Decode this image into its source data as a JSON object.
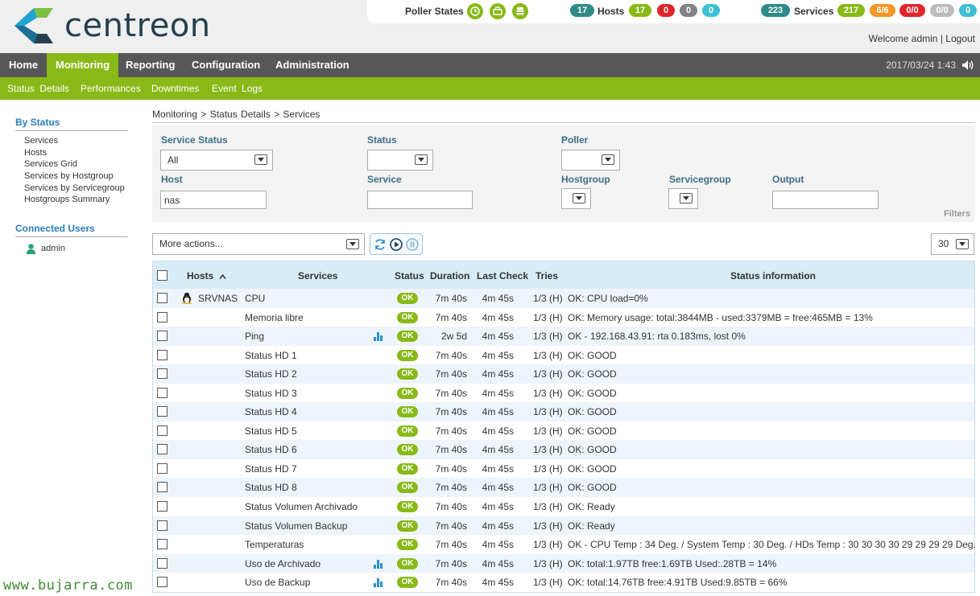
{
  "brand": "centreon",
  "header": {
    "poller_label": "Poller States",
    "hosts_total": "17",
    "hosts_label": "Hosts",
    "hosts_up": "17",
    "hosts_down": "0",
    "hosts_unreach": "0",
    "hosts_pending": "0",
    "services_total": "223",
    "services_label": "Services",
    "services_ok": "217",
    "services_warning": "6/6",
    "services_critical": "0/0",
    "services_unknown": "0/0",
    "services_pending": "0",
    "welcome": "Welcome admin",
    "separator": "|",
    "logout": "Logout"
  },
  "nav": {
    "items": [
      "Home",
      "Monitoring",
      "Reporting",
      "Configuration",
      "Administration"
    ],
    "datetime": "2017/03/24 1:43"
  },
  "subnav": [
    "Status Details",
    "Performances",
    "Downtimes",
    "Event Logs"
  ],
  "sidebar": {
    "by_status_title": "By Status",
    "links": [
      "Services",
      "Hosts",
      "Services Grid",
      "Services by Hostgroup",
      "Services by Servicegroup",
      "Hostgroups Summary"
    ],
    "users_title": "Connected Users",
    "user": "admin"
  },
  "watermark": "www.bujarra.com",
  "breadcrumb": "Monitoring  >  Status Details  >  Services",
  "filters": {
    "service_status_label": "Service Status",
    "service_status_value": "All",
    "status_label": "Status",
    "poller_label": "Poller",
    "host_label": "Host",
    "host_value": "nas",
    "service_label": "Service",
    "hostgroup_label": "Hostgroup",
    "servicegroup_label": "Servicegroup",
    "output_label": "Output",
    "filters_tag": "Filters"
  },
  "toolbar": {
    "more_actions": "More actions...",
    "page_size": "30"
  },
  "table": {
    "headers": {
      "hosts": "Hosts",
      "services": "Services",
      "status": "Status",
      "duration": "Duration",
      "last_check": "Last Check",
      "tries": "Tries",
      "status_info": "Status information"
    },
    "sort_indicator": "^",
    "host": "SRVNAS",
    "rows": [
      {
        "service": "CPU",
        "graph": false,
        "status": "OK",
        "duration": "7m 40s",
        "last_check": "4m 45s",
        "tries": "1/3 (H)",
        "info": "OK: CPU load=0%"
      },
      {
        "service": "Memoria libre",
        "graph": false,
        "status": "OK",
        "duration": "7m 40s",
        "last_check": "4m 45s",
        "tries": "1/3 (H)",
        "info": "OK: Memory usage: total:3844MB - used:3379MB = free:465MB = 13%"
      },
      {
        "service": "Ping",
        "graph": true,
        "status": "OK",
        "duration": "2w 5d",
        "last_check": "4m 45s",
        "tries": "1/3 (H)",
        "info": "OK - 192.168.43.91: rta 0.183ms, lost 0%"
      },
      {
        "service": "Status HD 1",
        "graph": false,
        "status": "OK",
        "duration": "7m 40s",
        "last_check": "4m 45s",
        "tries": "1/3 (H)",
        "info": "OK: GOOD"
      },
      {
        "service": "Status HD 2",
        "graph": false,
        "status": "OK",
        "duration": "7m 40s",
        "last_check": "4m 45s",
        "tries": "1/3 (H)",
        "info": "OK: GOOD"
      },
      {
        "service": "Status HD 3",
        "graph": false,
        "status": "OK",
        "duration": "7m 40s",
        "last_check": "4m 45s",
        "tries": "1/3 (H)",
        "info": "OK: GOOD"
      },
      {
        "service": "Status HD 4",
        "graph": false,
        "status": "OK",
        "duration": "7m 40s",
        "last_check": "4m 45s",
        "tries": "1/3 (H)",
        "info": "OK: GOOD"
      },
      {
        "service": "Status HD 5",
        "graph": false,
        "status": "OK",
        "duration": "7m 40s",
        "last_check": "4m 45s",
        "tries": "1/3 (H)",
        "info": "OK: GOOD"
      },
      {
        "service": "Status HD 6",
        "graph": false,
        "status": "OK",
        "duration": "7m 40s",
        "last_check": "4m 45s",
        "tries": "1/3 (H)",
        "info": "OK: GOOD"
      },
      {
        "service": "Status HD 7",
        "graph": false,
        "status": "OK",
        "duration": "7m 40s",
        "last_check": "4m 45s",
        "tries": "1/3 (H)",
        "info": "OK: GOOD"
      },
      {
        "service": "Status HD 8",
        "graph": false,
        "status": "OK",
        "duration": "7m 40s",
        "last_check": "4m 45s",
        "tries": "1/3 (H)",
        "info": "OK: GOOD"
      },
      {
        "service": "Status Volumen Archivado",
        "graph": false,
        "status": "OK",
        "duration": "7m 40s",
        "last_check": "4m 45s",
        "tries": "1/3 (H)",
        "info": "OK: Ready"
      },
      {
        "service": "Status Volumen Backup",
        "graph": false,
        "status": "OK",
        "duration": "7m 40s",
        "last_check": "4m 45s",
        "tries": "1/3 (H)",
        "info": "OK: Ready"
      },
      {
        "service": "Temperaturas",
        "graph": false,
        "status": "OK",
        "duration": "7m 40s",
        "last_check": "4m 45s",
        "tries": "1/3 (H)",
        "info": "OK - CPU Temp : 34 Deg. / System Temp : 30 Deg. / HDs Temp : 30 30 30 30 29 29 29 29 Deg."
      },
      {
        "service": "Uso de Archivado",
        "graph": true,
        "status": "OK",
        "duration": "7m 40s",
        "last_check": "4m 45s",
        "tries": "1/3 (H)",
        "info": "OK: total:1.97TB free:1.69TB Used:.28TB = 14%"
      },
      {
        "service": "Uso de Backup",
        "graph": true,
        "status": "OK",
        "duration": "7m 40s",
        "last_check": "4m 45s",
        "tries": "1/3 (H)",
        "info": "OK: total:14.76TB free:4.91TB Used:9.85TB = 66%"
      }
    ]
  },
  "colors": {
    "brand_green": "#88b917",
    "nav_dark": "#575757",
    "ok": "#88b917",
    "teal": "#2e8b87",
    "critical": "#e0262b",
    "warning": "#f29626",
    "unknown": "#bcbcbc",
    "pending": "#3cc0d2"
  },
  "icons": [
    "clock-icon",
    "poller-icon",
    "database-icon",
    "speaker-icon",
    "refresh-icon",
    "play-icon",
    "pause-icon",
    "linux-icon",
    "graph-icon",
    "user-icon"
  ]
}
